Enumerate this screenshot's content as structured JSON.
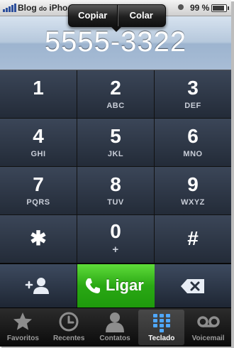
{
  "status_bar": {
    "carrier": "Blog",
    "carrier_small": "do",
    "carrier_rest": "iPho",
    "battery_text": "99 %",
    "battery_level": 0.99,
    "signal_bars": 5
  },
  "popup": {
    "copy_label": "Copiar",
    "paste_label": "Colar"
  },
  "display": {
    "number": "5555-3322"
  },
  "keypad": {
    "keys": [
      {
        "digit": "1",
        "letters": ""
      },
      {
        "digit": "2",
        "letters": "ABC"
      },
      {
        "digit": "3",
        "letters": "DEF"
      },
      {
        "digit": "4",
        "letters": "GHI"
      },
      {
        "digit": "5",
        "letters": "JKL"
      },
      {
        "digit": "6",
        "letters": "MNO"
      },
      {
        "digit": "7",
        "letters": "PQRS"
      },
      {
        "digit": "8",
        "letters": "TUV"
      },
      {
        "digit": "9",
        "letters": "WXYZ"
      },
      {
        "digit": "✱",
        "letters": ""
      },
      {
        "digit": "0",
        "letters": "+"
      },
      {
        "digit": "#",
        "letters": ""
      }
    ]
  },
  "actions": {
    "call_label": "Ligar",
    "call_color": "#2aa814"
  },
  "tabs": [
    {
      "label": "Favoritos",
      "icon": "star-icon"
    },
    {
      "label": "Recentes",
      "icon": "clock-icon"
    },
    {
      "label": "Contatos",
      "icon": "contact-icon"
    },
    {
      "label": "Teclado",
      "icon": "keypad-icon",
      "active": true
    },
    {
      "label": "Voicemail",
      "icon": "voicemail-icon"
    }
  ]
}
